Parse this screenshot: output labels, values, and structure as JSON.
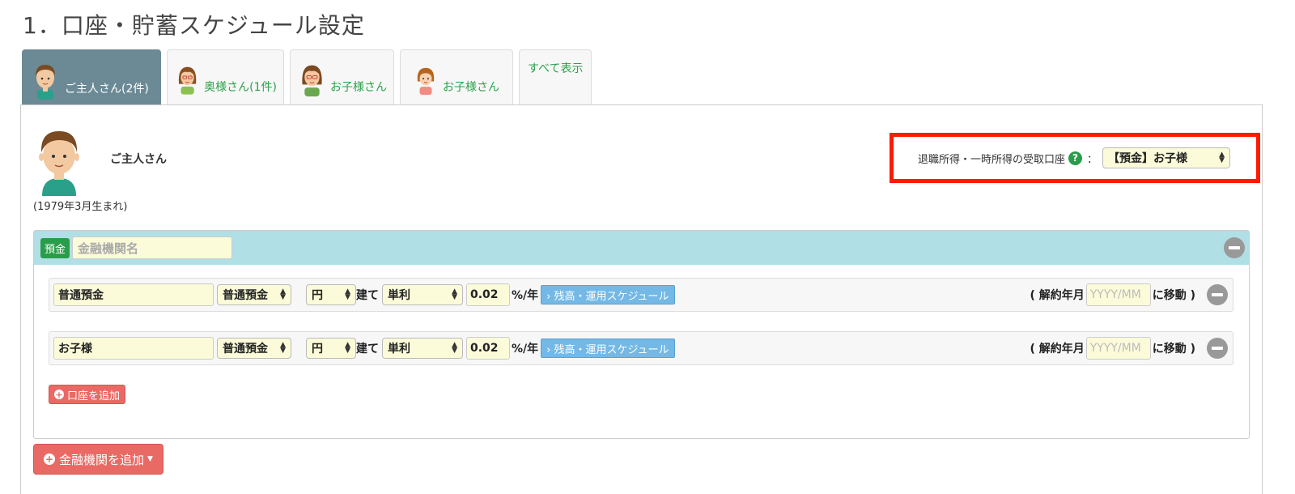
{
  "page": {
    "title": "1．口座・貯蓄スケジュール設定"
  },
  "tabs": [
    {
      "label": "ご主人さん(2件)",
      "avatar": "husband-avatar",
      "active": true
    },
    {
      "label": "奥様さん(1件)",
      "avatar": "wife-avatar",
      "active": false
    },
    {
      "label": "お子様さん",
      "avatar": "child-avatar",
      "active": false
    },
    {
      "label": "お子様さん",
      "avatar": "girl-avatar",
      "active": false
    },
    {
      "label": "すべて表示",
      "active": false
    }
  ],
  "profile": {
    "name": "ご主人さん",
    "birth": "(1979年3月生まれ)"
  },
  "retirement": {
    "label": "退職所得・一時所得の受取口座",
    "help_icon": "?",
    "colon": "：",
    "selected": "【預金】お子様"
  },
  "bank": {
    "badge": "預金",
    "name_placeholder": "金融機関名",
    "accounts": [
      {
        "name": "普通預金",
        "type": "普通預金",
        "currency": "円",
        "currency_suffix": "建て",
        "interest": "単利",
        "rate": "0.02",
        "rate_unit": "%/年",
        "schedule_button": "› 残高・運用スケジュール",
        "cancel_open": "( 解約年月",
        "date_placeholder": "YYYY/MM",
        "cancel_close": "に移動 )"
      },
      {
        "name": "お子様",
        "type": "普通預金",
        "currency": "円",
        "currency_suffix": "建て",
        "interest": "単利",
        "rate": "0.02",
        "rate_unit": "%/年",
        "schedule_button": "› 残高・運用スケジュール",
        "cancel_open": "( 解約年月",
        "date_placeholder": "YYYY/MM",
        "cancel_close": "に移動 )"
      }
    ],
    "add_account": "口座を追加"
  },
  "add_bank": "金融機関を追加",
  "colors": {
    "accent_green": "#2a9d4a",
    "tab_active": "#6b8a96",
    "highlight_red": "#ff1a00",
    "add_red": "#e96a65",
    "schedule_blue": "#74b8e6",
    "bank_header": "#b1dfe6"
  }
}
